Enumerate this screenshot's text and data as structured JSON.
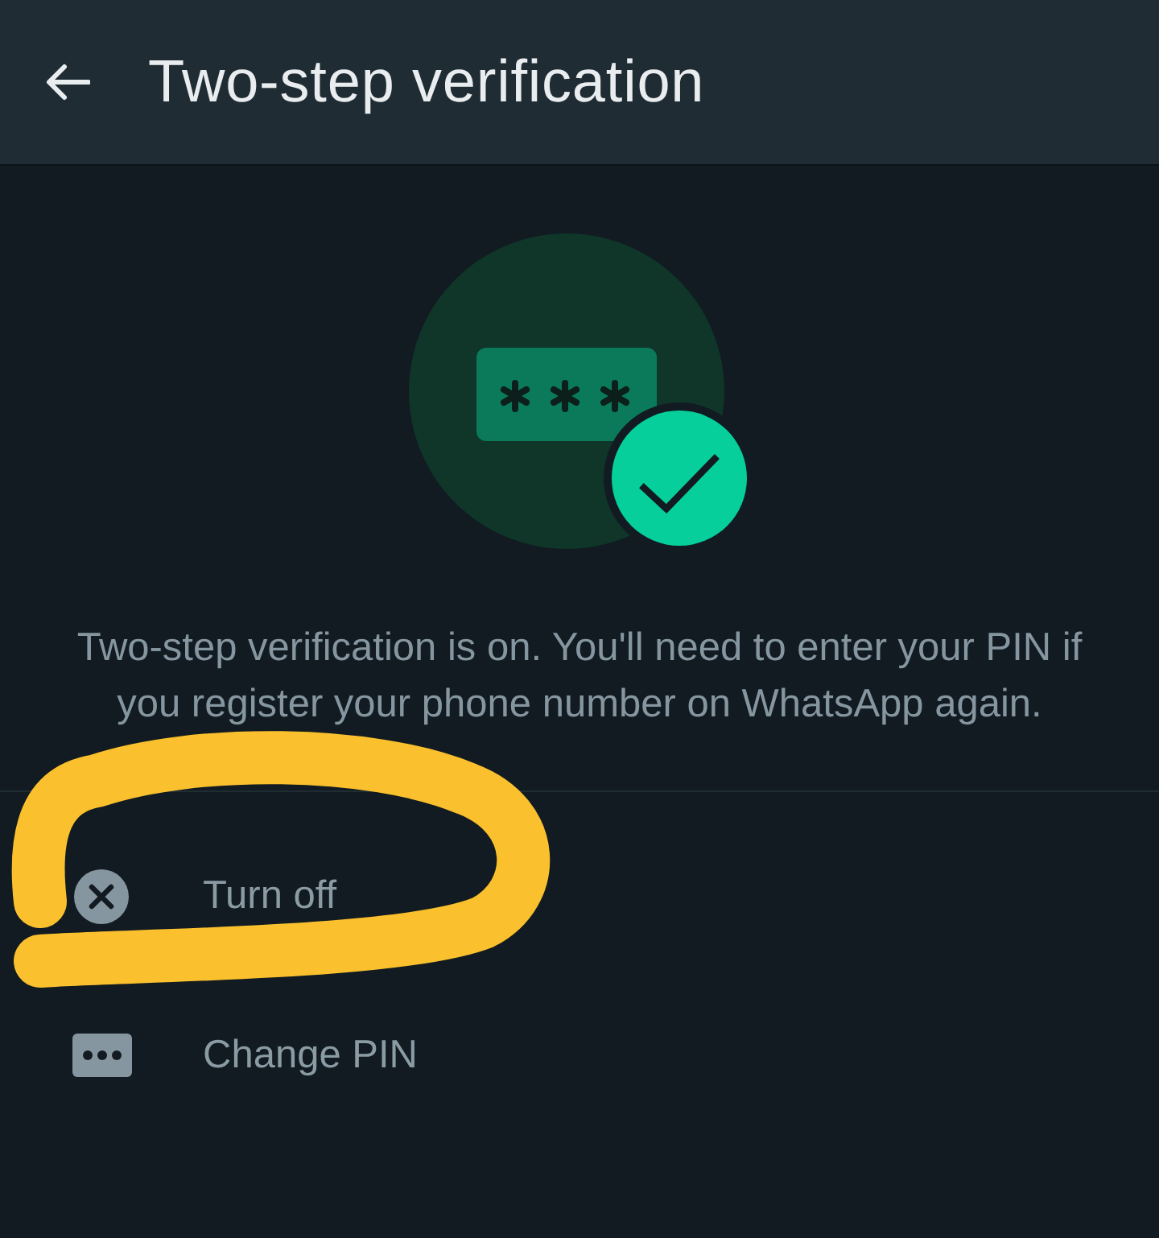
{
  "header": {
    "title": "Two-step verification"
  },
  "status": {
    "enabled": true,
    "message": "Two-step verification is on. You'll need to enter your PIN if you register your phone number on WhatsApp again."
  },
  "actions": [
    {
      "kind": "turn-off",
      "label": "Turn off",
      "highlighted": true
    },
    {
      "kind": "change-pin",
      "label": "Change PIN",
      "highlighted": false
    }
  ]
}
